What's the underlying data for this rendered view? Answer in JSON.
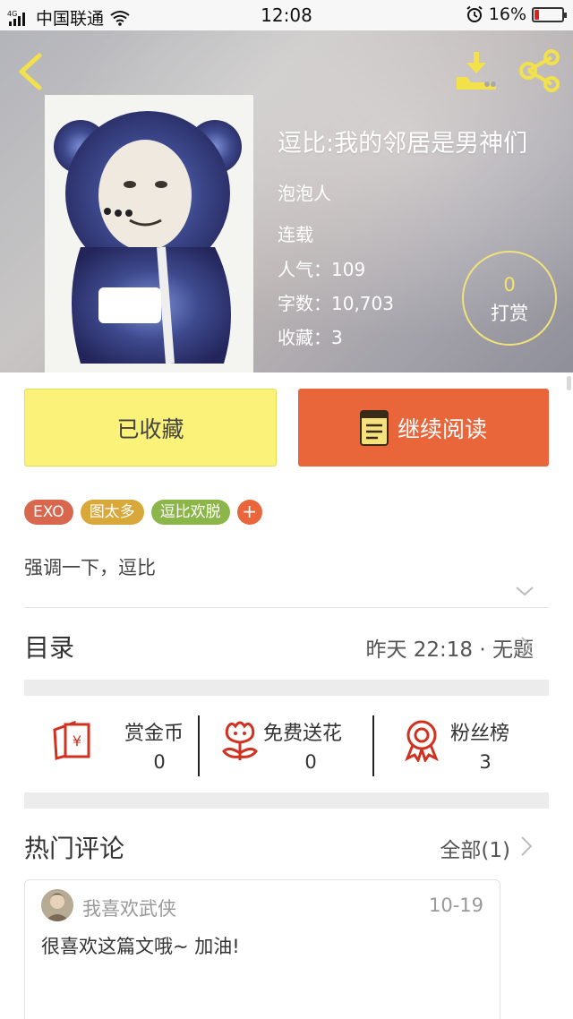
{
  "status_bar": {
    "carrier": "中国联通",
    "network": "4G",
    "time": "12:08",
    "battery": "16%",
    "battery_level": 0.16
  },
  "book": {
    "title": "逗比:我的邻居是男神们",
    "author": "泡泡人",
    "status": "连载",
    "popularity": "人气：109",
    "word_count": "字数：10,703",
    "favorites": "收藏：3",
    "tip_count": "0",
    "tip_label": "打赏"
  },
  "actions": {
    "favorited_label": "已收藏",
    "continue_label": "继续阅读"
  },
  "tags": [
    {
      "label": "EXO",
      "color": "#d9674e"
    },
    {
      "label": "图太多",
      "color": "#d9a83a"
    },
    {
      "label": "逗比欢脱",
      "color": "#8cb54a"
    }
  ],
  "tag_add_label": "+",
  "description": "强调一下，逗比",
  "toc": {
    "label": "目录",
    "latest": "昨天 22:18 · 无题"
  },
  "stats": [
    {
      "label": "赏金币",
      "value": "0",
      "icon": "red-envelope-icon"
    },
    {
      "label": "免费送花",
      "value": "0",
      "icon": "flower-icon"
    },
    {
      "label": "粉丝榜",
      "value": "3",
      "icon": "award-ribbon-icon"
    }
  ],
  "comments_section": {
    "label": "热门评论",
    "all_label": "全部(1)"
  },
  "comment": {
    "user": "我喜欢武侠",
    "date": "10-19",
    "text": "很喜欢这篇文哦~ 加油!"
  },
  "colors": {
    "accent_orange": "#e8663a",
    "accent_yellow": "#fbf27a",
    "icon_yellow": "#f2e14a",
    "stat_icon_red": "#d0321f"
  }
}
